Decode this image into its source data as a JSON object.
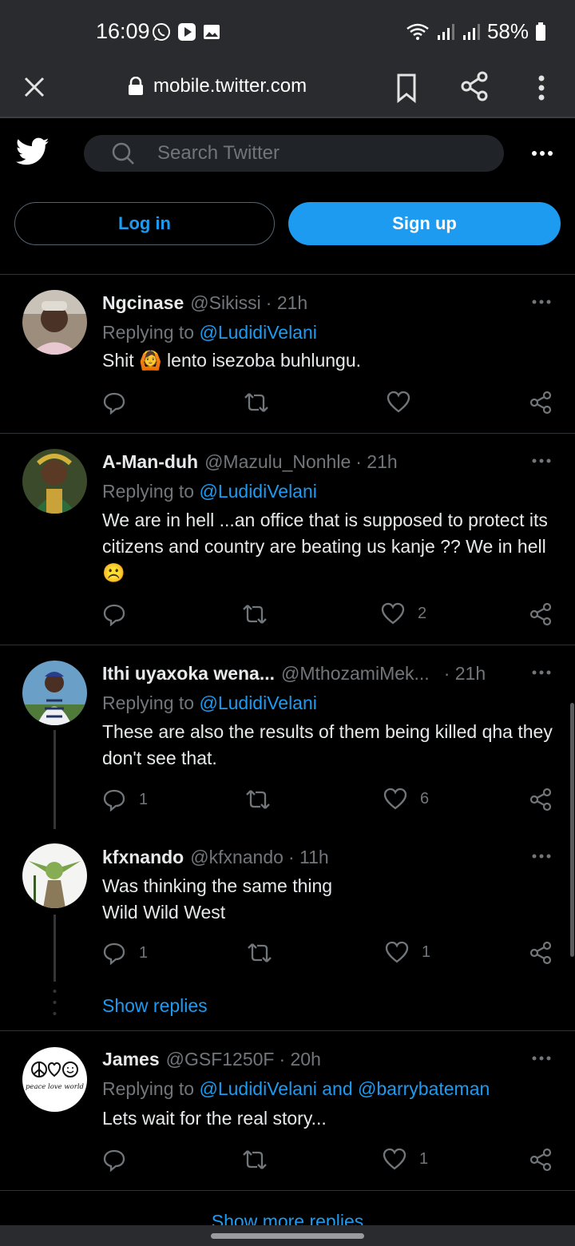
{
  "status": {
    "time": "16:09",
    "battery": "58%"
  },
  "browser": {
    "url": "mobile.twitter.com"
  },
  "twitter": {
    "search_placeholder": "Search Twitter",
    "login_label": "Log in",
    "signup_label": "Sign up"
  },
  "tweets": [
    {
      "name": "Ngcinase",
      "handle": "@Sikissi",
      "time": "· 21h",
      "replying_prefix": "Replying to",
      "replying_to": "@LudidiVelani",
      "text": "Shit 🙆 lento isezoba buhlungu.",
      "replies": "",
      "retweets": "",
      "likes": ""
    },
    {
      "name": "A-Man-duh",
      "handle": "@Mazulu_Nonhle",
      "time": "· 21h",
      "replying_prefix": "Replying to",
      "replying_to": "@LudidiVelani",
      "text": "We are in hell ...an office that is supposed to protect its citizens and country are beating us kanje ?? We in hell ☹️",
      "replies": "",
      "retweets": "",
      "likes": "2"
    },
    {
      "name": "Ithi uyaxoka wena...",
      "handle": "@MthozamiMek...",
      "time": "· 21h",
      "replying_prefix": "Replying to",
      "replying_to": "@LudidiVelani",
      "text": "These are also the results of them being killed  qha they don't  see that.",
      "replies": "1",
      "retweets": "",
      "likes": "6"
    },
    {
      "name": "kfxnando",
      "handle": "@kfxnando",
      "time": "· 11h",
      "line1": "Was thinking the same thing",
      "line2": "Wild Wild West",
      "replies": "1",
      "retweets": "",
      "likes": "1"
    },
    {
      "name": "James",
      "handle": "@GSF1250F",
      "time": "· 20h",
      "replying_prefix": "Replying to",
      "replying_to": "@LudidiVelani and @barrybateman",
      "text": "Lets wait for the real story...",
      "replies": "",
      "retweets": "",
      "likes": "1"
    }
  ],
  "show_replies_label": "Show replies",
  "show_more_replies_label": "Show more replies",
  "avatar_text": "peace love world",
  "colors": {
    "accent": "#1d9bf0",
    "background": "#000000",
    "muted": "#71767b",
    "chrome": "#2a2b2e"
  }
}
